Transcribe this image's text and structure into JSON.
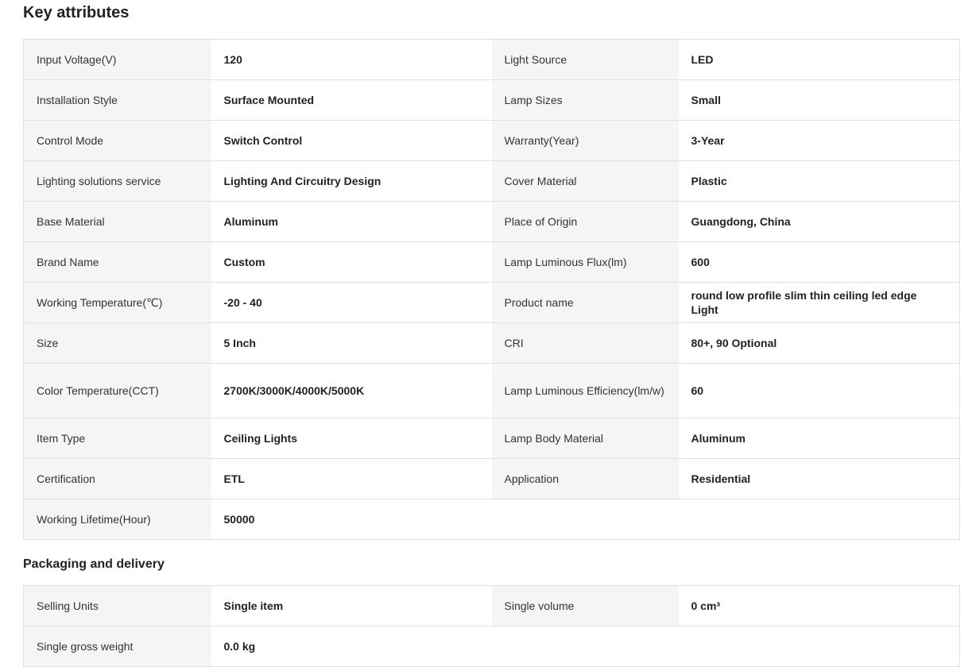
{
  "key_attributes": {
    "title": "Key attributes",
    "rows": [
      {
        "k1": "Input Voltage(V)",
        "v1": "120",
        "k2": "Light Source",
        "v2": "LED"
      },
      {
        "k1": "Installation Style",
        "v1": "Surface Mounted",
        "k2": "Lamp Sizes",
        "v2": "Small"
      },
      {
        "k1": "Control Mode",
        "v1": "Switch Control",
        "k2": "Warranty(Year)",
        "v2": "3-Year"
      },
      {
        "k1": "Lighting solutions service",
        "v1": "Lighting And Circuitry Design",
        "k2": "Cover Material",
        "v2": "Plastic"
      },
      {
        "k1": "Base Material",
        "v1": "Aluminum",
        "k2": "Place of Origin",
        "v2": "Guangdong, China"
      },
      {
        "k1": "Brand Name",
        "v1": "Custom",
        "k2": "Lamp Luminous Flux(lm)",
        "v2": "600"
      },
      {
        "k1": "Working Temperature(℃)",
        "v1": "-20 - 40",
        "k2": "Product name",
        "v2": "round low profile slim thin ceiling led edge Light"
      },
      {
        "k1": "Size",
        "v1": "5 Inch",
        "k2": "CRI",
        "v2": "80+, 90 Optional"
      },
      {
        "k1": "Color Temperature(CCT)",
        "v1": "2700K/3000K/4000K/5000K",
        "k2": "Lamp Luminous Efficiency(lm/w)",
        "v2": "60"
      },
      {
        "k1": "Item Type",
        "v1": "Ceiling Lights",
        "k2": "Lamp Body Material",
        "v2": "Aluminum"
      },
      {
        "k1": "Certification",
        "v1": "ETL",
        "k2": "Application",
        "v2": "Residential"
      },
      {
        "k1": "Working Lifetime(Hour)",
        "v1": "50000"
      }
    ]
  },
  "packaging": {
    "title": "Packaging and delivery",
    "rows": [
      {
        "k1": "Selling Units",
        "v1": "Single item",
        "k2": "Single volume",
        "v2": "0 cm³"
      },
      {
        "k1": "Single gross weight",
        "v1": "0.0 kg"
      }
    ]
  }
}
